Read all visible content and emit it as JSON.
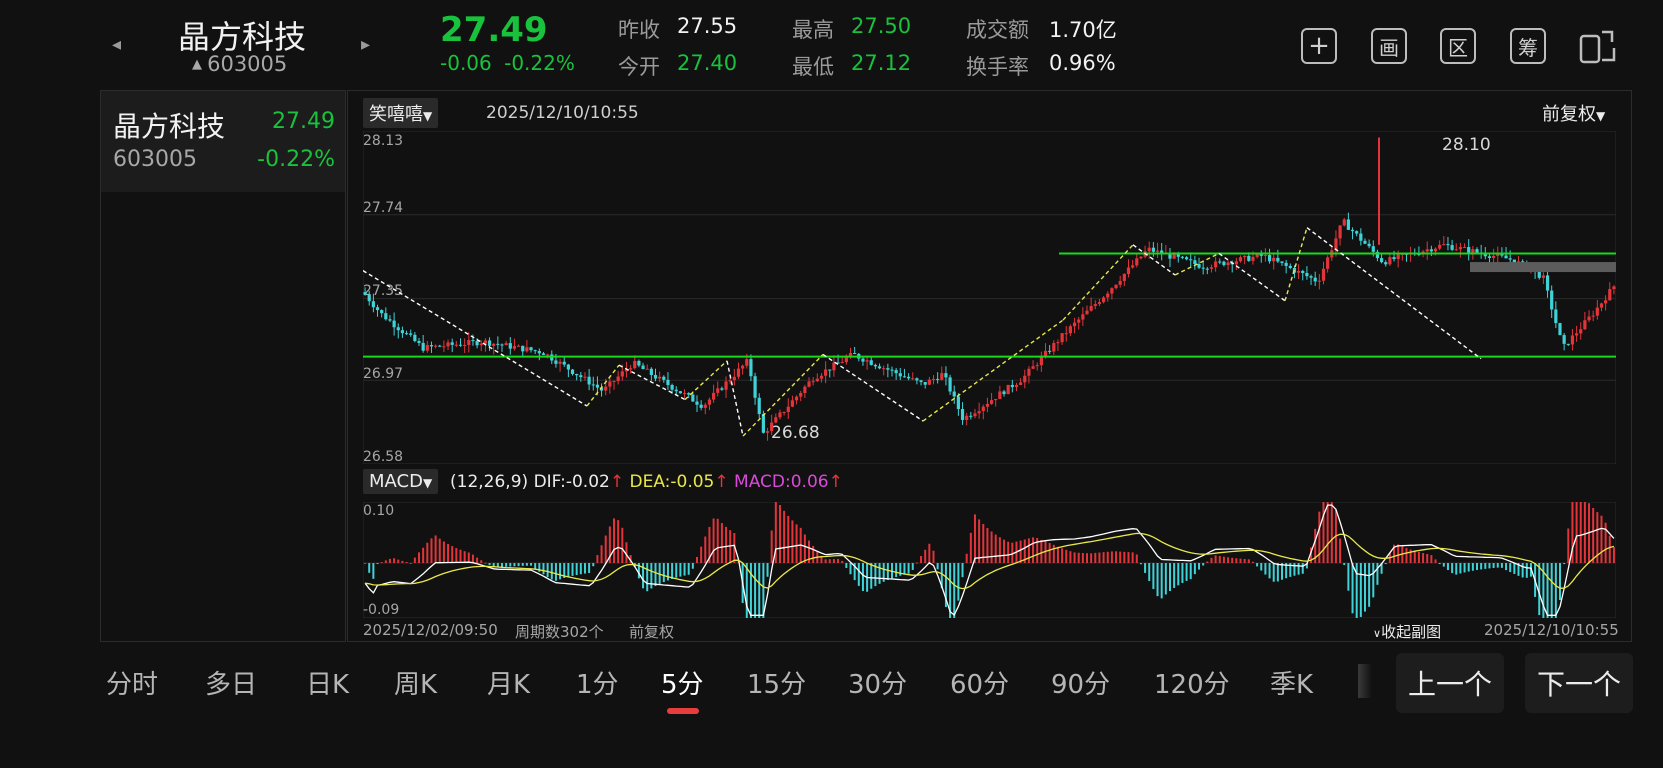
{
  "header": {
    "name": "晶方科技",
    "code": "603005",
    "price": "27.49",
    "change": "-0.06",
    "change_pct": "-0.22%",
    "stats": [
      {
        "label": "昨收",
        "value": "27.55",
        "tone": "white"
      },
      {
        "label": "今开",
        "value": "27.40",
        "tone": "green"
      },
      {
        "label": "最高",
        "value": "27.50",
        "tone": "green"
      },
      {
        "label": "最低",
        "value": "27.12",
        "tone": "green"
      },
      {
        "label": "成交额",
        "value": "1.70亿",
        "tone": "white"
      },
      {
        "label": "换手率",
        "value": "0.96%",
        "tone": "white"
      }
    ],
    "toolbar": [
      {
        "name": "add-icon",
        "glyph": "+"
      },
      {
        "name": "draw-icon",
        "glyph": "画"
      },
      {
        "name": "range-icon",
        "glyph": "区"
      },
      {
        "name": "chips-icon",
        "glyph": "筹"
      },
      {
        "name": "rotate-screen-icon",
        "glyph": "⇆"
      }
    ]
  },
  "watchlist": {
    "name": "晶方科技",
    "price": "27.49",
    "code": "603005",
    "pct": "-0.22%"
  },
  "chart": {
    "indicator_selector": "笑嘻嘻",
    "datetime": "2025/12/10/10:55",
    "adjust_selector": "前复权",
    "price_axis": [
      "28.13",
      "27.74",
      "27.35",
      "26.97",
      "26.58"
    ],
    "high_label": "28.10",
    "low_label": "26.68",
    "macd": {
      "selector": "MACD",
      "params": "(12,26,9)",
      "dif": "DIF:-0.02",
      "dea": "DEA:-0.05",
      "macd": "MACD:0.06",
      "axis_top": "0.10",
      "axis_bottom": "-0.09"
    },
    "footer": {
      "start": "2025/12/02/09:50",
      "count": "周期数302个",
      "adjust": "前复权",
      "collapse": "收起副图",
      "end": "2025/12/10/10:55"
    }
  },
  "chart_data": {
    "type": "candlestick",
    "timeframe": "5分",
    "candles": 302,
    "x_range": [
      "2025/12/02/09:50",
      "2025/12/10/10:55"
    ],
    "ylim": [
      26.58,
      28.13
    ],
    "y_ticks": [
      28.13,
      27.74,
      27.35,
      26.97,
      26.58
    ],
    "high": 28.1,
    "low": 26.68,
    "support_line": 27.08,
    "resistance_line": 27.56,
    "macd_ylim": [
      -0.09,
      0.1
    ],
    "macd_last": {
      "DIF": -0.02,
      "DEA": -0.05,
      "MACD": 0.06
    }
  },
  "periods": [
    "分时",
    "多日",
    "日K",
    "周K",
    "月K",
    "1分",
    "5分",
    "15分",
    "30分",
    "60分",
    "90分",
    "120分",
    "季K"
  ],
  "active_period": "5分",
  "prev_button": "上一个",
  "next_button": "下一个",
  "colors": {
    "up": "#e3343a",
    "down": "#3fd3d8",
    "accent_line": "#19d91a",
    "zigzag": "#e8e84a"
  }
}
